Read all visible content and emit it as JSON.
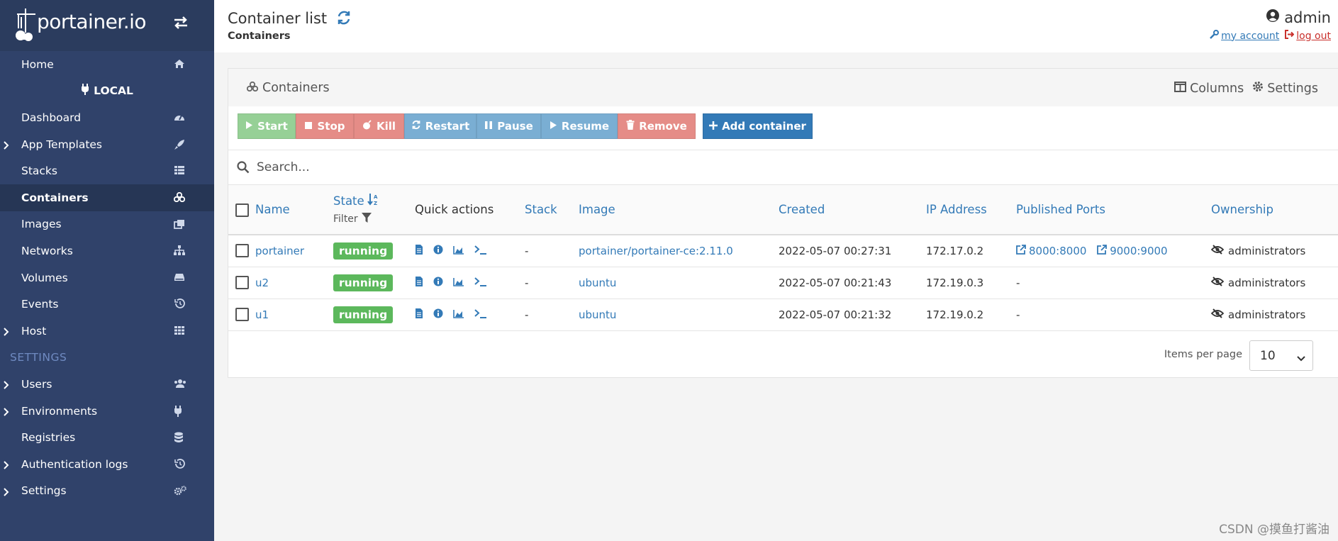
{
  "brand": {
    "name": "portainer.io"
  },
  "sidebar": {
    "home": "Home",
    "endpoint": "LOCAL",
    "items": [
      {
        "label": "Dashboard",
        "icon": "tachometer-icon",
        "chevron": false
      },
      {
        "label": "App Templates",
        "icon": "rocket-icon",
        "chevron": true
      },
      {
        "label": "Stacks",
        "icon": "th-list-icon",
        "chevron": false
      },
      {
        "label": "Containers",
        "icon": "cubes-icon",
        "chevron": false,
        "active": true
      },
      {
        "label": "Images",
        "icon": "clone-icon",
        "chevron": false
      },
      {
        "label": "Networks",
        "icon": "sitemap-icon",
        "chevron": false
      },
      {
        "label": "Volumes",
        "icon": "hdd-icon",
        "chevron": false
      },
      {
        "label": "Events",
        "icon": "history-icon",
        "chevron": false
      },
      {
        "label": "Host",
        "icon": "th-icon",
        "chevron": true
      }
    ],
    "settings_heading": "SETTINGS",
    "settings_items": [
      {
        "label": "Users",
        "icon": "users-icon",
        "chevron": true
      },
      {
        "label": "Environments",
        "icon": "plug-icon",
        "chevron": true
      },
      {
        "label": "Registries",
        "icon": "database-icon",
        "chevron": false
      },
      {
        "label": "Authentication logs",
        "icon": "history-icon",
        "chevron": true
      },
      {
        "label": "Settings",
        "icon": "cogs-icon",
        "chevron": true
      }
    ]
  },
  "header": {
    "title": "Container list",
    "breadcrumb": "Containers",
    "username": "admin",
    "my_account": "my account",
    "log_out": "log out"
  },
  "panel": {
    "title": "Containers",
    "columns_label": "Columns",
    "settings_label": "Settings",
    "buttons": {
      "start": "Start",
      "stop": "Stop",
      "kill": "Kill",
      "restart": "Restart",
      "pause": "Pause",
      "resume": "Resume",
      "remove": "Remove",
      "add": "Add container"
    },
    "search_placeholder": "Search...",
    "columns": {
      "name": "Name",
      "state": "State",
      "state_filter": "Filter",
      "quick_actions": "Quick actions",
      "stack": "Stack",
      "image": "Image",
      "created": "Created",
      "ip": "IP Address",
      "ports": "Published Ports",
      "ownership": "Ownership"
    },
    "rows": [
      {
        "name": "portainer",
        "state": "running",
        "stack": "-",
        "image": "portainer/portainer-ce:2.11.0",
        "created": "2022-05-07 00:27:31",
        "ip": "172.17.0.2",
        "port1": "8000:8000",
        "port2": "9000:9000",
        "ports_text": "",
        "ownership": "administrators"
      },
      {
        "name": "u2",
        "state": "running",
        "stack": "-",
        "image": "ubuntu",
        "created": "2022-05-07 00:21:43",
        "ip": "172.19.0.3",
        "port1": "",
        "port2": "",
        "ports_text": "-",
        "ownership": "administrators"
      },
      {
        "name": "u1",
        "state": "running",
        "stack": "-",
        "image": "ubuntu",
        "created": "2022-05-07 00:21:32",
        "ip": "172.19.0.2",
        "port1": "",
        "port2": "",
        "ports_text": "-",
        "ownership": "administrators"
      }
    ],
    "items_per_page_label": "Items per page",
    "items_per_page_value": "10"
  },
  "watermark": "CSDN @摸鱼打酱油",
  "colors": {
    "sidebar_bg": "#30426a",
    "link": "#337ab7",
    "running": "#5cb85c",
    "danger": "#e58c87",
    "info": "#7aaed3",
    "success_light": "#96d096",
    "logout": "#c9302c"
  }
}
